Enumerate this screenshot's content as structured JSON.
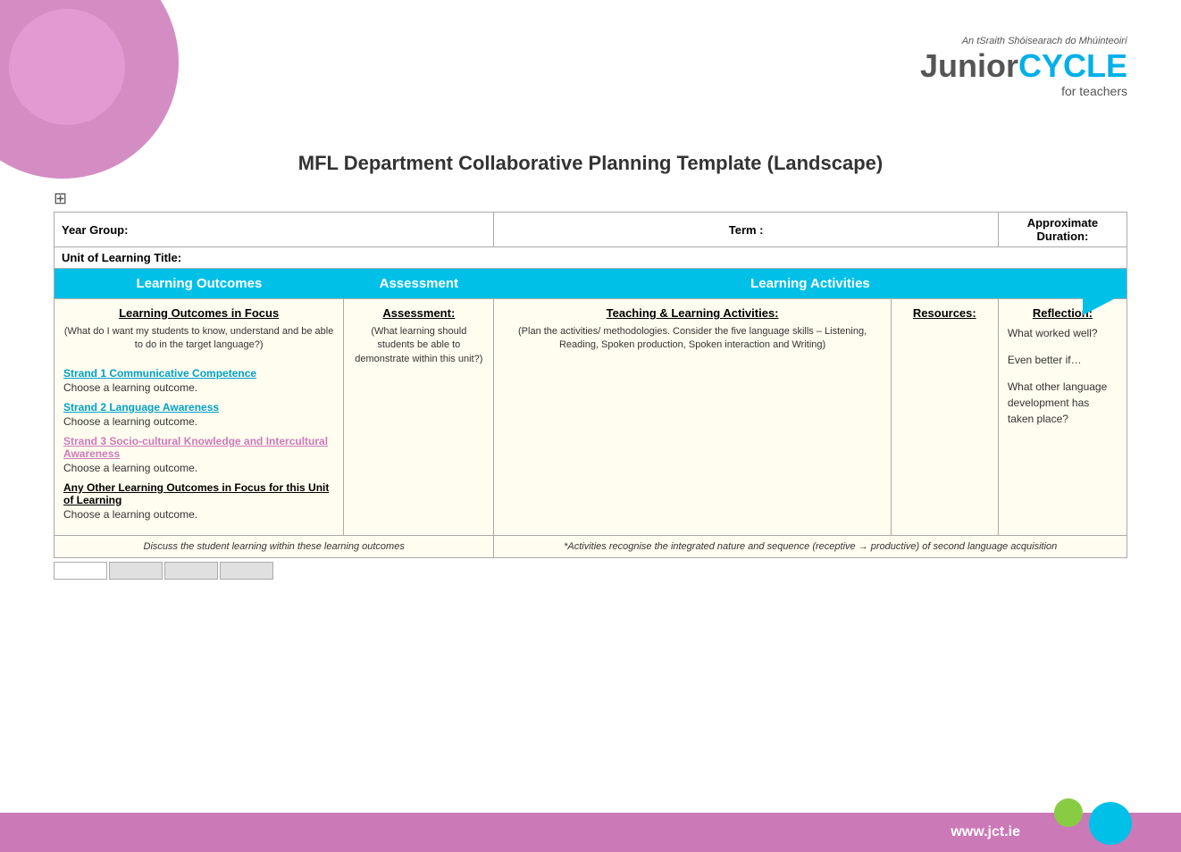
{
  "logo": {
    "subtitle": "An tSraith Shóisearach do Mhúinteoirí",
    "junior": "Junior",
    "cycle": "CYCLE",
    "for_teachers": "for teachers"
  },
  "page": {
    "title": "MFL Department Collaborative Planning Template (Landscape)"
  },
  "info_row1": {
    "year_group_label": "Year Group:",
    "term_label": "Term :",
    "duration_label": "Approximate Duration:"
  },
  "info_row2": {
    "unit_label": "Unit of Learning Title:"
  },
  "arrow_headers": {
    "outcomes": "Learning Outcomes",
    "assessment": "Assessment",
    "activities": "Learning Activities"
  },
  "columns": {
    "outcomes_header": "Learning Outcomes in Focus",
    "outcomes_subtext": "(What do I want my students to know, understand and be able to do in the target language?)",
    "assessment_header": "Assessment:",
    "assessment_subtext": "(What learning should students be able to demonstrate within this unit?)",
    "activities_header": "Teaching & Learning Activities:",
    "activities_subtext": "(Plan the activities/ methodologies. Consider the five language skills – Listening, Reading, Spoken production, Spoken interaction and Writing)",
    "resources_header": "Resources:",
    "reflection_header": "Reflection:"
  },
  "strands": {
    "strand1_label": "Strand 1 Communicative Competence",
    "strand1_choose": "Choose a learning outcome.",
    "strand2_label": "Strand 2 Language Awareness",
    "strand2_choose": "Choose a learning outcome.",
    "strand3_label": "Strand 3 Socio-cultural Knowledge and Intercultural Awareness",
    "strand3_choose": "Choose a learning outcome.",
    "other_label": "Any Other Learning Outcomes in Focus for this Unit of Learning",
    "other_choose": "Choose a learning outcome."
  },
  "reflection": {
    "line1": "What worked well?",
    "line2": "Even better if…",
    "line3": "What other language development has taken place?"
  },
  "footer": {
    "left": "Discuss the student learning within these learning outcomes",
    "right": "*Activities recognise the integrated nature and sequence (receptive → productive) of second language acquisition"
  },
  "bottom": {
    "url": "www.jct.ie"
  }
}
